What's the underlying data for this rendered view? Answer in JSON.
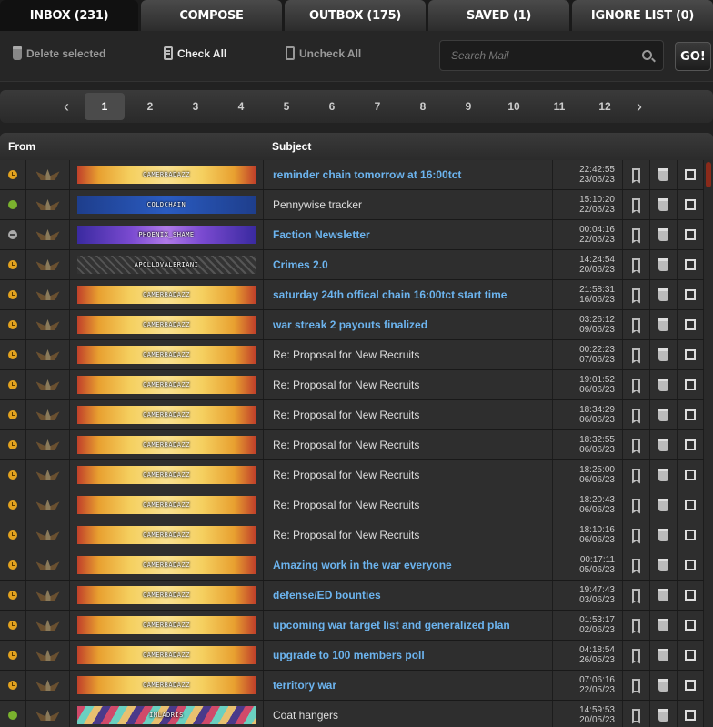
{
  "tabs": [
    {
      "label": "INBOX (231)",
      "active": true
    },
    {
      "label": "COMPOSE",
      "active": false
    },
    {
      "label": "OUTBOX (175)",
      "active": false
    },
    {
      "label": "SAVED (1)",
      "active": false
    },
    {
      "label": "IGNORE LIST (0)",
      "active": false
    }
  ],
  "toolbar": {
    "delete_label": "Delete selected",
    "check_all_label": "Check All",
    "uncheck_all_label": "Uncheck All",
    "search_placeholder": "Search Mail",
    "go_label": "GO!"
  },
  "pagination": {
    "prev": "‹",
    "next": "›",
    "pages": [
      "1",
      "2",
      "3",
      "4",
      "5",
      "6",
      "7",
      "8",
      "9",
      "10",
      "11",
      "12"
    ],
    "current": "1"
  },
  "table": {
    "col_from": "From",
    "col_subject": "Subject"
  },
  "colors": {
    "unread_subject": "#6cb4ef",
    "status_away": "#e2a21f",
    "status_online": "#7ab22e",
    "status_offline": "#aaaaaa"
  },
  "messages": [
    {
      "status": "away",
      "sender": "GAMERBADAZZ",
      "banner": "gold",
      "subject": "reminder chain tomorrow at 16:00tct",
      "unread": true,
      "time": "22:42:55",
      "date": "23/06/23"
    },
    {
      "status": "online",
      "sender": "COLDCHAIN",
      "banner": "blue",
      "subject": "Pennywise tracker",
      "unread": false,
      "time": "15:10:20",
      "date": "22/06/23"
    },
    {
      "status": "offline",
      "sender": "PHOENIX_SHAME",
      "banner": "purple",
      "subject": "Faction Newsletter",
      "unread": true,
      "time": "00:04:16",
      "date": "22/06/23"
    },
    {
      "status": "away",
      "sender": "APOLLOVALERIANI",
      "banner": "map",
      "subject": "Crimes 2.0",
      "unread": true,
      "time": "14:24:54",
      "date": "20/06/23"
    },
    {
      "status": "away",
      "sender": "GAMERBADAZZ",
      "banner": "gold",
      "subject": "saturday 24th offical chain 16:00tct start time",
      "unread": true,
      "time": "21:58:31",
      "date": "16/06/23"
    },
    {
      "status": "away",
      "sender": "GAMERBADAZZ",
      "banner": "gold",
      "subject": "war streak 2 payouts finalized",
      "unread": true,
      "time": "03:26:12",
      "date": "09/06/23"
    },
    {
      "status": "away",
      "sender": "GAMERBADAZZ",
      "banner": "gold",
      "subject": "Re: Proposal for New Recruits",
      "unread": false,
      "time": "00:22:23",
      "date": "07/06/23"
    },
    {
      "status": "away",
      "sender": "GAMERBADAZZ",
      "banner": "gold",
      "subject": "Re: Proposal for New Recruits",
      "unread": false,
      "time": "19:01:52",
      "date": "06/06/23"
    },
    {
      "status": "away",
      "sender": "GAMERBADAZZ",
      "banner": "gold",
      "subject": "Re: Proposal for New Recruits",
      "unread": false,
      "time": "18:34:29",
      "date": "06/06/23"
    },
    {
      "status": "away",
      "sender": "GAMERBADAZZ",
      "banner": "gold",
      "subject": "Re: Proposal for New Recruits",
      "unread": false,
      "time": "18:32:55",
      "date": "06/06/23"
    },
    {
      "status": "away",
      "sender": "GAMERBADAZZ",
      "banner": "gold",
      "subject": "Re: Proposal for New Recruits",
      "unread": false,
      "time": "18:25:00",
      "date": "06/06/23"
    },
    {
      "status": "away",
      "sender": "GAMERBADAZZ",
      "banner": "gold",
      "subject": "Re: Proposal for New Recruits",
      "unread": false,
      "time": "18:20:43",
      "date": "06/06/23"
    },
    {
      "status": "away",
      "sender": "GAMERBADAZZ",
      "banner": "gold",
      "subject": "Re: Proposal for New Recruits",
      "unread": false,
      "time": "18:10:16",
      "date": "06/06/23"
    },
    {
      "status": "away",
      "sender": "GAMERBADAZZ",
      "banner": "gold",
      "subject": "Amazing work in the war everyone",
      "unread": true,
      "time": "00:17:11",
      "date": "05/06/23"
    },
    {
      "status": "away",
      "sender": "GAMERBADAZZ",
      "banner": "gold",
      "subject": "defense/ED bounties",
      "unread": true,
      "time": "19:47:43",
      "date": "03/06/23"
    },
    {
      "status": "away",
      "sender": "GAMERBADAZZ",
      "banner": "gold",
      "subject": "upcoming war target list and generalized plan",
      "unread": true,
      "time": "01:53:17",
      "date": "02/06/23"
    },
    {
      "status": "away",
      "sender": "GAMERBADAZZ",
      "banner": "gold",
      "subject": "upgrade to 100 members poll",
      "unread": true,
      "time": "04:18:54",
      "date": "26/05/23"
    },
    {
      "status": "away",
      "sender": "GAMERBADAZZ",
      "banner": "gold",
      "subject": "territory war",
      "unread": true,
      "time": "07:06:16",
      "date": "22/05/23"
    },
    {
      "status": "online",
      "sender": "IMLADRIS",
      "banner": "stripe",
      "subject": "Coat hangers",
      "unread": false,
      "time": "14:59:53",
      "date": "20/05/23"
    }
  ]
}
